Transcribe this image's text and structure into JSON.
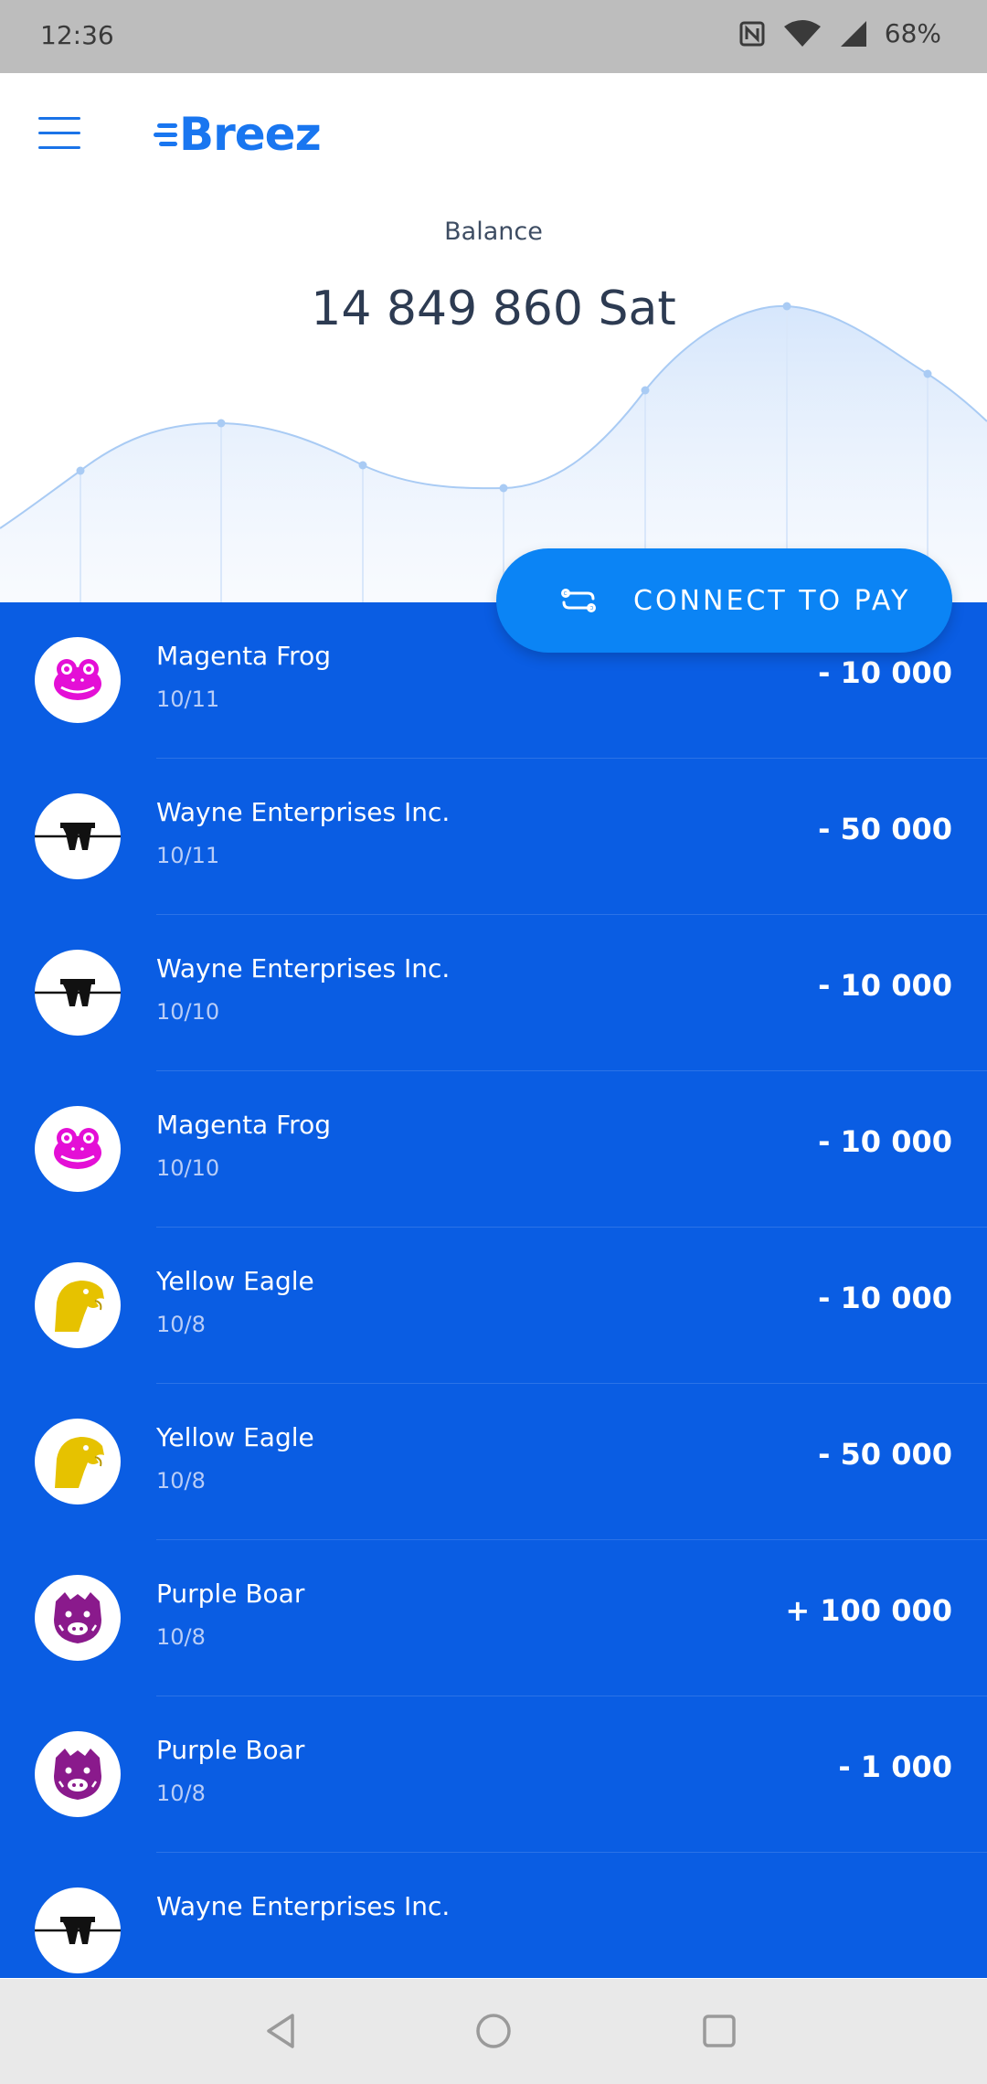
{
  "status_bar": {
    "time": "12:36",
    "battery": "68%"
  },
  "app": {
    "logo_text": "Breez",
    "accent_color": "#1976f0"
  },
  "balance": {
    "label": "Balance",
    "value": "14 849 860 Sat"
  },
  "connect_button": {
    "label": "CONNECT TO PAY"
  },
  "transactions": [
    {
      "name": "Magenta Frog",
      "date": "10/11",
      "amount": "- 10 000",
      "avatar": "magenta-frog-icon"
    },
    {
      "name": "Wayne Enterprises Inc.",
      "date": "10/11",
      "amount": "- 50 000",
      "avatar": "wayne-enterprises-icon"
    },
    {
      "name": "Wayne Enterprises Inc.",
      "date": "10/10",
      "amount": "- 10 000",
      "avatar": "wayne-enterprises-icon"
    },
    {
      "name": "Magenta Frog",
      "date": "10/10",
      "amount": "- 10 000",
      "avatar": "magenta-frog-icon"
    },
    {
      "name": "Yellow Eagle",
      "date": "10/8",
      "amount": "- 10 000",
      "avatar": "yellow-eagle-icon"
    },
    {
      "name": "Yellow Eagle",
      "date": "10/8",
      "amount": "- 50 000",
      "avatar": "yellow-eagle-icon"
    },
    {
      "name": "Purple Boar",
      "date": "10/8",
      "amount": "+ 100 000",
      "avatar": "purple-boar-icon"
    },
    {
      "name": "Purple Boar",
      "date": "10/8",
      "amount": "- 1 000",
      "avatar": "purple-boar-icon"
    },
    {
      "name": "Wayne Enterprises Inc.",
      "date": "",
      "amount": "",
      "avatar": "wayne-enterprises-icon"
    }
  ],
  "colors": {
    "list_background": "#0a5de3",
    "button_background": "#0b84f5",
    "frog": "#e40fd6",
    "eagle": "#e6c200",
    "boar": "#8a1a8c"
  }
}
